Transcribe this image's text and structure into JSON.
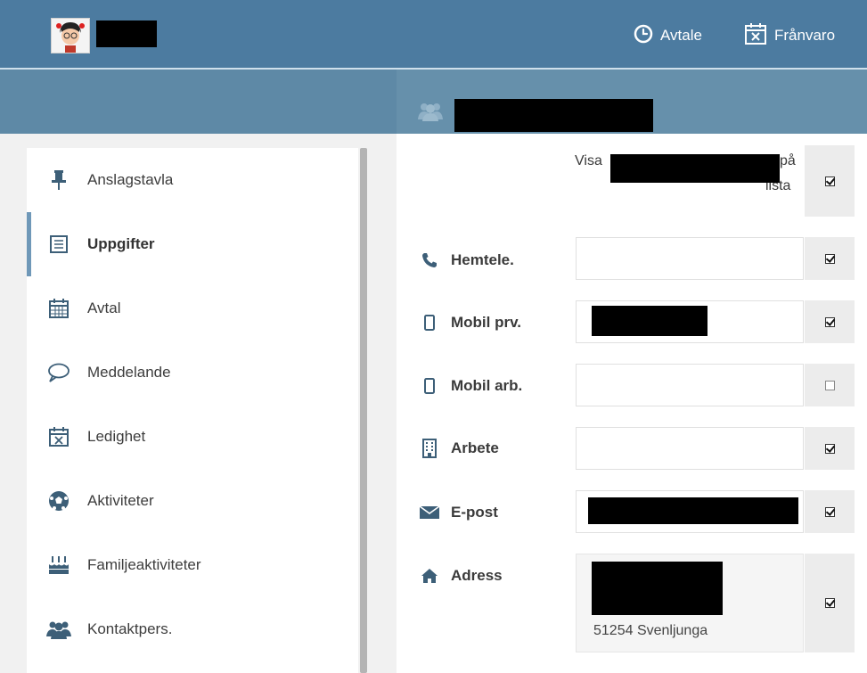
{
  "header": {
    "appointment_label": "Avtale",
    "absence_label": "Frånvaro"
  },
  "sidebar": {
    "items": [
      {
        "label": "Anslagstavla",
        "icon": "pin-icon"
      },
      {
        "label": "Uppgifter",
        "icon": "list-icon",
        "active": true
      },
      {
        "label": "Avtal",
        "icon": "calendar-icon"
      },
      {
        "label": "Meddelande",
        "icon": "chat-bubble-icon"
      },
      {
        "label": "Ledighet",
        "icon": "calendar-x-icon"
      },
      {
        "label": "Aktiviteter",
        "icon": "soccer-ball-icon"
      },
      {
        "label": "Familjeaktiviteter",
        "icon": "cake-icon"
      },
      {
        "label": "Kontaktpers.",
        "icon": "group-icon"
      }
    ]
  },
  "form": {
    "visa_prefix": "Visa",
    "visa_suffix_1": "på",
    "visa_suffix_2": "lista",
    "rows": [
      {
        "label": "Hemtele.",
        "icon": "phone-icon",
        "checked": true
      },
      {
        "label": "Mobil prv.",
        "icon": "mobile-icon",
        "checked": true
      },
      {
        "label": "Mobil arb.",
        "icon": "mobile-icon",
        "checked": false
      },
      {
        "label": "Arbete",
        "icon": "building-icon",
        "checked": true
      },
      {
        "label": "E-post",
        "icon": "envelope-icon",
        "checked": true
      },
      {
        "label": "Adress",
        "icon": "home-icon",
        "checked": true
      }
    ],
    "address_line": "51254 Svenljunga"
  },
  "colors": {
    "topbar": "#4c7ba0",
    "subbar": "#6690ab",
    "active_indicator": "#6f98b8"
  }
}
